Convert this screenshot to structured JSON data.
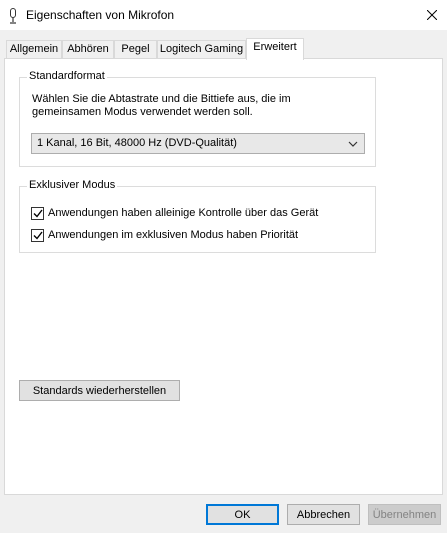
{
  "window": {
    "title": "Eigenschaften von Mikrofon",
    "icon": "microphone-icon",
    "close_icon": "close-icon"
  },
  "tabs": [
    {
      "label": "Allgemein",
      "active": false
    },
    {
      "label": "Abhören",
      "active": false
    },
    {
      "label": "Pegel",
      "active": false
    },
    {
      "label": "Logitech Gaming",
      "active": false
    },
    {
      "label": "Erweitert",
      "active": true
    }
  ],
  "standard_format": {
    "title": "Standardformat",
    "description": "Wählen Sie die Abtastrate und die Bittiefe aus, die im gemeinsamen Modus verwendet werden soll.",
    "selected_format": "1 Kanal, 16 Bit, 48000 Hz (DVD-Qualität)"
  },
  "exclusive_mode": {
    "title": "Exklusiver Modus",
    "options": [
      {
        "label": "Anwendungen haben alleinige Kontrolle über das Gerät",
        "checked": true
      },
      {
        "label": "Anwendungen im exklusiven Modus haben Priorität",
        "checked": true
      }
    ]
  },
  "restore_defaults_label": "Standards wiederherstellen",
  "footer": {
    "ok_label": "OK",
    "cancel_label": "Abbrechen",
    "apply_label": "Übernehmen"
  },
  "colors": {
    "accent": "#0078d7",
    "panel_bg": "#ffffff",
    "window_bg": "#f0f0f0"
  }
}
